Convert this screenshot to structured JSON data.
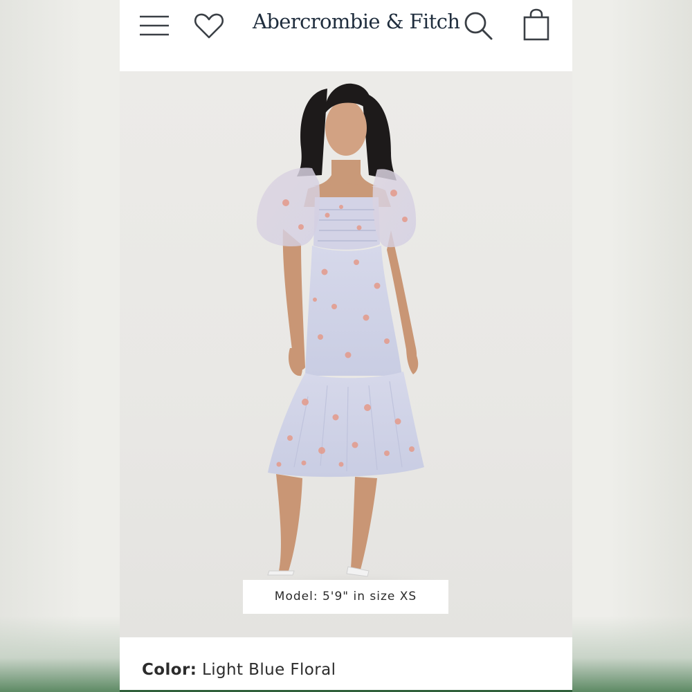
{
  "header": {
    "brand": "Abercrombie & Fitch",
    "icons": {
      "menu": "hamburger-menu-icon",
      "wishlist": "heart-icon",
      "search": "search-icon",
      "bag": "shopping-bag-icon"
    }
  },
  "product": {
    "model_caption": "Model: 5'9\" in size XS",
    "color_label": "Color:",
    "color_value": "Light Blue Floral"
  },
  "colors": {
    "brand_text": "#1f2d3d",
    "background": "#ececea",
    "dress": "#cfd3e6",
    "accent_green": "#2f5f3a"
  }
}
